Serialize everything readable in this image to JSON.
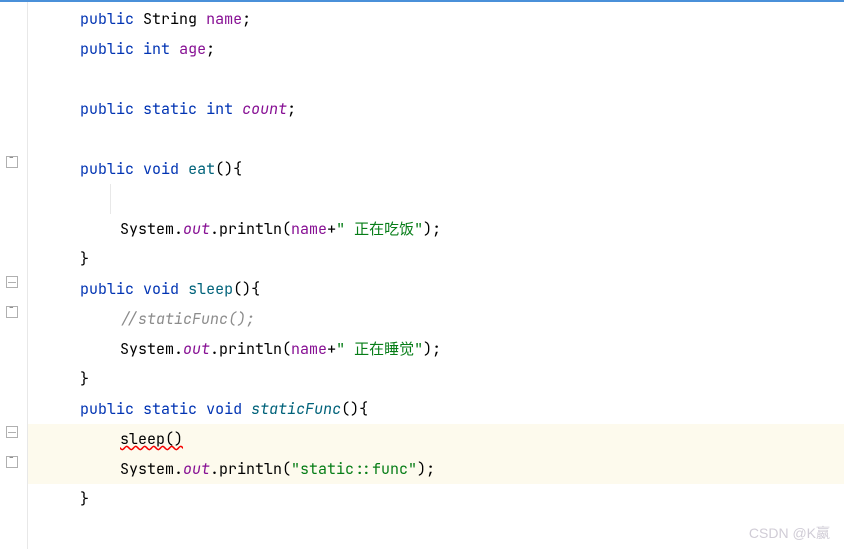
{
  "code": {
    "line1": {
      "kw1": "public",
      "type": "String",
      "field": "name",
      "end": ";"
    },
    "line2": {
      "kw1": "public",
      "kw2": "int",
      "field": "age",
      "end": ";"
    },
    "line3": {
      "kw1": "public",
      "kw2": "static",
      "kw3": "int",
      "field": "count",
      "end": ";"
    },
    "line4": {
      "kw1": "public",
      "kw2": "void",
      "method": "eat",
      "end": "(){"
    },
    "line5": {
      "obj": "System.",
      "out": "out",
      "call": ".println(",
      "field": "name",
      "plus": "+",
      "str": "\" 正在吃饭\"",
      "end": ");"
    },
    "line6": {
      "brace": "}"
    },
    "line7": {
      "kw1": "public",
      "kw2": "void",
      "method": "sleep",
      "end": "(){"
    },
    "line8": {
      "comment": "//staticFunc();"
    },
    "line9": {
      "obj": "System.",
      "out": "out",
      "call": ".println(",
      "field": "name",
      "plus": "+",
      "str": "\" 正在睡觉\"",
      "end": ");"
    },
    "line10": {
      "brace": "}"
    },
    "line11": {
      "kw1": "public",
      "kw2": "static",
      "kw3": "void",
      "method": "staticFunc",
      "end": "(){"
    },
    "line12": {
      "err": "sleep()"
    },
    "line13": {
      "obj": "System.",
      "out": "out",
      "call": ".println(",
      "str": "\"static::func\"",
      "end": ");"
    },
    "line14": {
      "brace": "}"
    }
  },
  "watermark": "CSDN @K嬴"
}
